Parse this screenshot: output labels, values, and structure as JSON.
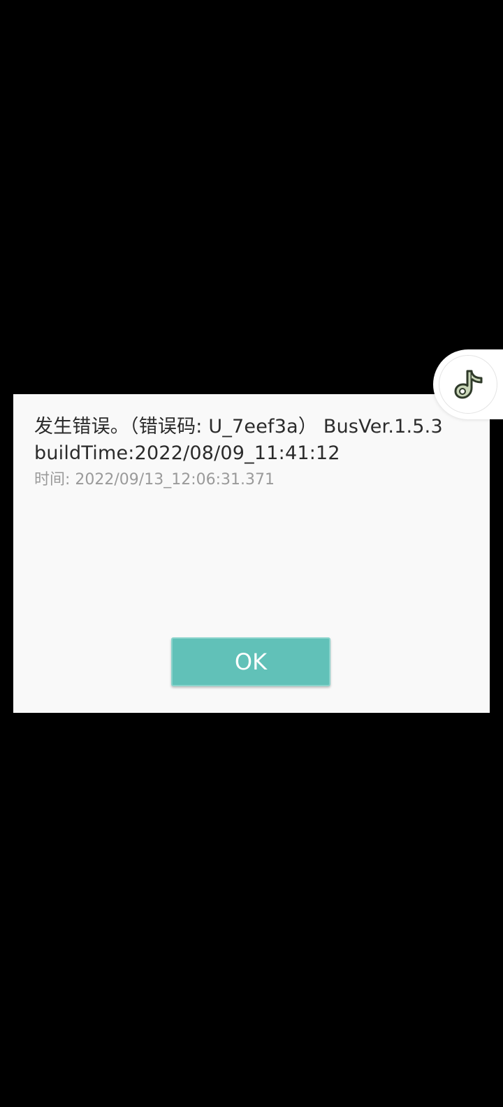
{
  "dialog": {
    "message": "发生错误。（错误码: U_7eef3a） BusVer.1.5.3 buildTime:2022/08/09_11:41:12",
    "timestamp": "时间: 2022/09/13_12:06:31.371",
    "ok_label": "OK"
  },
  "floating_widget": {
    "icon": "music-note-icon"
  },
  "colors": {
    "background": "#000000",
    "dialog_background": "#f9f9f9",
    "button_accent": "#61c1b8",
    "message_text": "#2b2b2b",
    "timestamp_text": "#9a9a9a"
  }
}
